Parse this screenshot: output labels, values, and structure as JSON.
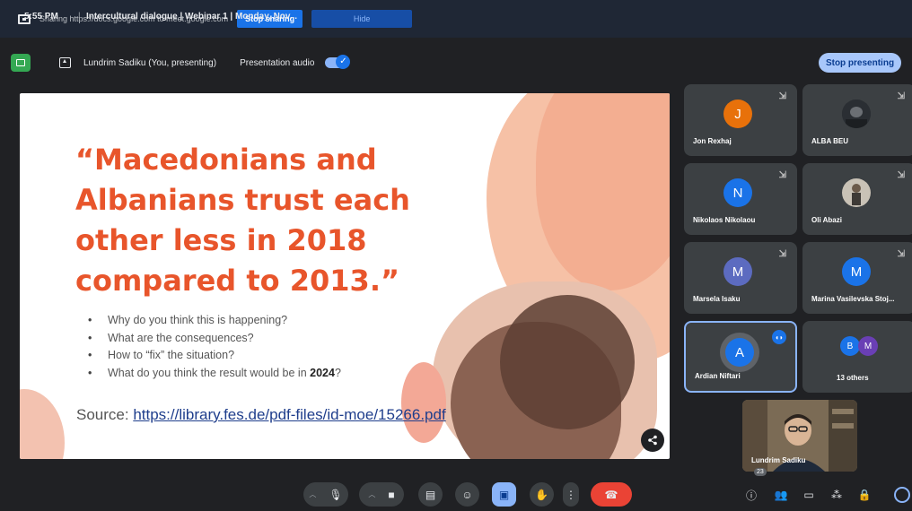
{
  "share_bar": {
    "text": "Sharing https://docs.google.com to meet.google.com",
    "stop_sharing": "Stop sharing",
    "hide": "Hide"
  },
  "presenting_bar": {
    "presenter": "Lundrim Sadiku (You, presenting)",
    "audio_label": "Presentation audio",
    "audio_enabled": true,
    "stop_presenting": "Stop presenting"
  },
  "slide": {
    "title": "“Macedonians and Albanians trust each other less in 2018 compared to 2013.”",
    "bullets": [
      {
        "text": "Why do you think this is happening?"
      },
      {
        "text": "What are the consequences?"
      },
      {
        "text": "How to “fix” the situation?"
      },
      {
        "text": "What do you think the result would be in ",
        "bold": "2024",
        "suffix": "?"
      }
    ],
    "source_label": "Source: ",
    "source_link": "https://library.fes.de/pdf-files/id-moe/15266.pdf",
    "accent_color": "#e8552b"
  },
  "participants": [
    {
      "name": "Jon Rexhaj",
      "initial": "J",
      "color": "#e8710a"
    },
    {
      "name": "ALBA BEU",
      "initial": "",
      "photo": true
    },
    {
      "name": "Nikolaos Nikolaou",
      "initial": "N",
      "color": "#1a73e8"
    },
    {
      "name": "Oli Abazi",
      "initial": "",
      "photo": true
    },
    {
      "name": "Marsela Isaku",
      "initial": "M",
      "color": "#5c6bc0"
    },
    {
      "name": "Marina Vasilevska Stoj...",
      "initial": "M",
      "color": "#1a73e8"
    },
    {
      "name": "Ardian Niftari",
      "initial": "A",
      "color": "#1a73e8",
      "speaking": true
    }
  ],
  "others": {
    "label": "13 others",
    "initials": [
      "B",
      "M"
    ],
    "colors": [
      "#1a73e8",
      "#6a3fb5"
    ]
  },
  "self_view": {
    "name": "Lundrim Sadiku"
  },
  "bottom": {
    "time": "5:55 PM",
    "separator": "|",
    "meeting_title": "Intercultural dialogue | Webinar 1 | Monday, Nov...",
    "participant_count": "23"
  }
}
